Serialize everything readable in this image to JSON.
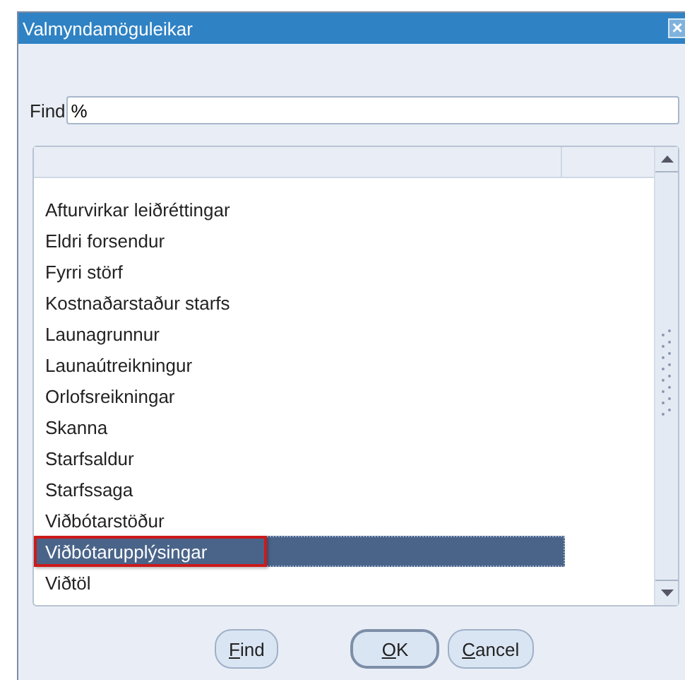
{
  "window": {
    "title": "Valmyndamöguleikar",
    "close": "×"
  },
  "find": {
    "label": "Find",
    "value": "%"
  },
  "list": {
    "items": [
      {
        "label": "Afturvirkar leiðréttingar",
        "selected": false,
        "annotated": false
      },
      {
        "label": "Eldri forsendur",
        "selected": false,
        "annotated": false
      },
      {
        "label": "Fyrri störf",
        "selected": false,
        "annotated": false
      },
      {
        "label": "Kostnaðarstaður starfs",
        "selected": false,
        "annotated": false
      },
      {
        "label": "Launagrunnur",
        "selected": false,
        "annotated": false
      },
      {
        "label": "Launaútreikningur",
        "selected": false,
        "annotated": false
      },
      {
        "label": "Orlofsreikningar",
        "selected": false,
        "annotated": false
      },
      {
        "label": "Skanna",
        "selected": false,
        "annotated": false
      },
      {
        "label": "Starfsaldur",
        "selected": false,
        "annotated": false
      },
      {
        "label": "Starfssaga",
        "selected": false,
        "annotated": false
      },
      {
        "label": "Viðbótarstöður",
        "selected": false,
        "annotated": false
      },
      {
        "label": "Viðbótarupplýsingar",
        "selected": true,
        "annotated": true
      },
      {
        "label": "Viðtöl",
        "selected": false,
        "annotated": false
      }
    ]
  },
  "buttons": [
    {
      "key": "F",
      "rest": "ind",
      "default": false
    },
    {
      "key": "O",
      "rest": "K",
      "default": true
    },
    {
      "key": "C",
      "rest": "ancel",
      "default": false
    }
  ]
}
